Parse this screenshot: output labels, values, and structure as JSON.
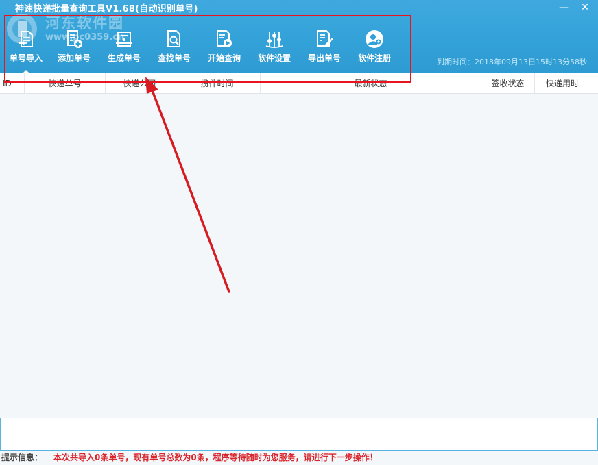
{
  "window": {
    "title": "神速快递批量查询工具V1.68(自动识别单号)",
    "minimize_glyph": "—",
    "close_glyph": "✕"
  },
  "watermark": {
    "brand": "河东软件园",
    "url": "www.pc0359.cn"
  },
  "toolbar": {
    "items": [
      {
        "label": "单号导入",
        "icon": "import-icon"
      },
      {
        "label": "添加单号",
        "icon": "add-document-icon"
      },
      {
        "label": "生成单号",
        "icon": "generate-icon"
      },
      {
        "label": "查找单号",
        "icon": "find-document-icon"
      },
      {
        "label": "开始查询",
        "icon": "play-document-icon"
      },
      {
        "label": "软件设置",
        "icon": "sliders-icon"
      },
      {
        "label": "导出单号",
        "icon": "export-document-icon"
      },
      {
        "label": "软件注册",
        "icon": "user-add-icon"
      }
    ],
    "active_index": 0
  },
  "expiry": {
    "text": "到期时间：2018年09月13日15时13分58秒"
  },
  "table": {
    "columns": [
      "ID",
      "快递单号",
      "快递公司",
      "揽件时间",
      "最新状态",
      "签收状态",
      "快递用时"
    ],
    "rows": []
  },
  "status": {
    "label": "提示信息：",
    "message": "本次共导入0条单号，现有单号总数为0条，程序等待随时为您服务，请进行下一步操作！"
  },
  "colors": {
    "titlebar": "#33a2d8",
    "highlight": "#e8151e",
    "status_message": "#d9262c",
    "panel_border": "#56b3e2"
  }
}
